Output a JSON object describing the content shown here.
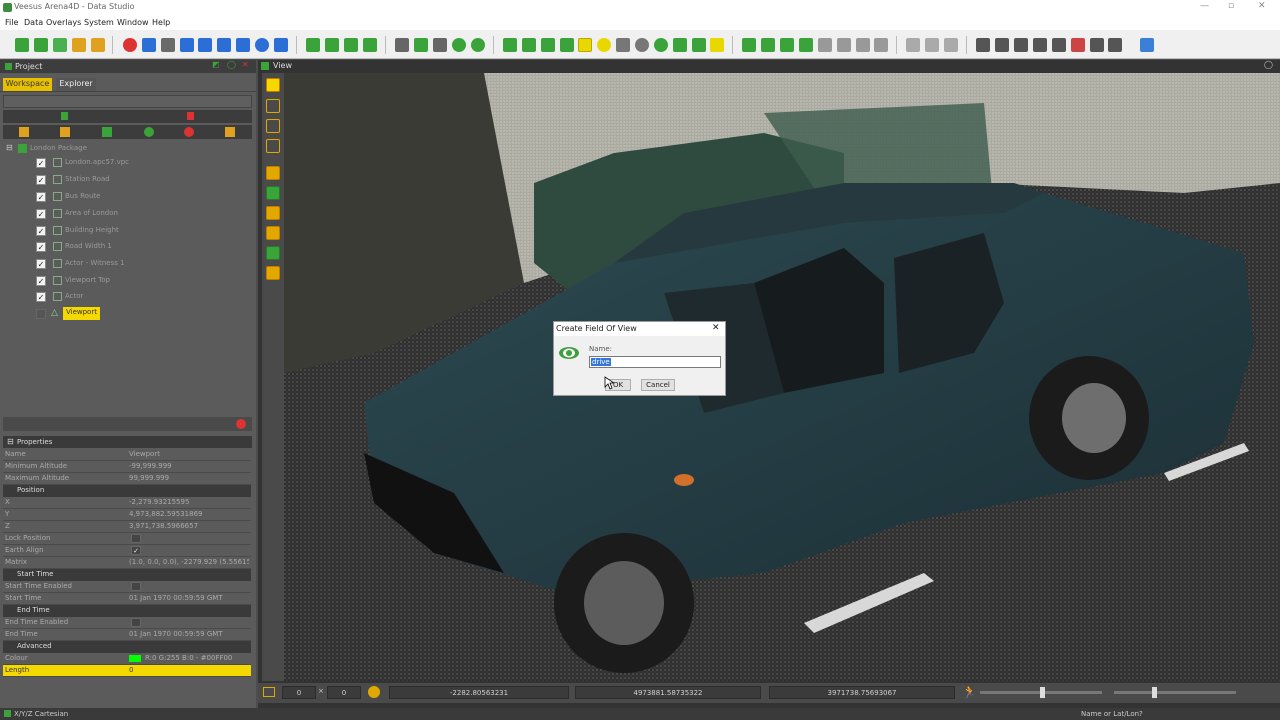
{
  "window": {
    "title": "Veesus Arena4D - Data Studio"
  },
  "menu": [
    "File",
    "Data",
    "Overlays",
    "System",
    "Window",
    "Help"
  ],
  "project_panel": {
    "title": "Project",
    "tabs": [
      "Workspace",
      "Explorer"
    ],
    "root": "London Package",
    "items": [
      {
        "label": "London.apc57.vpc",
        "checked": true
      },
      {
        "label": "Station Road",
        "checked": true
      },
      {
        "label": "Bus Route",
        "checked": true
      },
      {
        "label": "Area of London",
        "checked": true
      },
      {
        "label": "Building Height",
        "checked": true
      },
      {
        "label": "Road Width 1",
        "checked": true
      },
      {
        "label": "Actor - Witness 1",
        "checked": true
      },
      {
        "label": "Viewport Top",
        "checked": true
      },
      {
        "label": "Actor",
        "checked": true
      },
      {
        "label": "Viewport",
        "checked": false,
        "selected": true
      }
    ]
  },
  "properties": {
    "title": "Properties",
    "rows": [
      {
        "k": "Name",
        "v": "Viewport"
      },
      {
        "k": "Minimum Altitude",
        "v": "-99,999.999"
      },
      {
        "k": "Maximum Altitude",
        "v": "99,999.999"
      }
    ],
    "position_title": "Position",
    "position": [
      {
        "k": "X",
        "v": "-2,279.93215595"
      },
      {
        "k": "Y",
        "v": "4,973,882.59531869"
      },
      {
        "k": "Z",
        "v": "3,971,738.5966657"
      },
      {
        "k": "Lock Position",
        "v": ""
      },
      {
        "k": "Earth Align",
        "v": "✓"
      },
      {
        "k": "Matrix",
        "v": "(1.0, 0.0, 0.0), -2279.929 (5.55615000...)"
      }
    ],
    "start_title": "Start Time",
    "start": [
      {
        "k": "Start Time Enabled",
        "v": ""
      },
      {
        "k": "Start Time",
        "v": "01 Jan 1970 00:59:59 GMT"
      }
    ],
    "end_title": "End Time",
    "end": [
      {
        "k": "End Time Enabled",
        "v": ""
      },
      {
        "k": "End Time",
        "v": "01 Jan 1970 00:59:59 GMT"
      }
    ],
    "adv_title": "Advanced",
    "adv": [
      {
        "k": "Colour",
        "v": "R:0 G:255 B:0 - #00FF00"
      },
      {
        "k": "Length",
        "v": "0"
      }
    ]
  },
  "view": {
    "title": "View"
  },
  "dialog": {
    "title": "Create Field Of View",
    "name_label": "Name:",
    "name_value": "drive",
    "ok": "OK",
    "cancel": "Cancel"
  },
  "bottom": {
    "x": "-2282.80563231",
    "y": "4973881.58735322",
    "z": "3971738.75693067",
    "field1": "0",
    "field2": "0"
  },
  "status": {
    "left": "X/Y/Z Cartesian",
    "right": "Name or Lat/Lon?"
  }
}
